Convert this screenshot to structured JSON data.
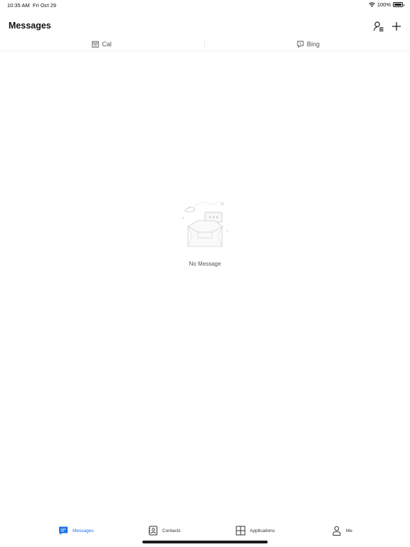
{
  "status_bar": {
    "time": "10:35 AM",
    "date": "Fri Oct 29",
    "battery": "100%",
    "wifi_icon": "wifi-icon",
    "battery_icon": "battery-icon"
  },
  "header": {
    "title": "Messages",
    "actions": [
      {
        "name": "contacts-list-icon"
      },
      {
        "name": "plus-icon"
      }
    ]
  },
  "sub_tabs": [
    {
      "label": "Cal",
      "icon": "calendar-icon"
    },
    {
      "label": "Bing",
      "icon": "bing-chat-icon"
    }
  ],
  "empty_state": {
    "message": "No Message",
    "illustration": "empty-inbox-illustration"
  },
  "bottom_nav": {
    "active_color": "#1a73e8",
    "items": [
      {
        "label": "Messages",
        "icon": "chat-bubble-icon",
        "active": true
      },
      {
        "label": "Contacts",
        "icon": "contacts-book-icon",
        "active": false
      },
      {
        "label": "Applications",
        "icon": "grid-icon",
        "active": false
      },
      {
        "label": "Me",
        "icon": "person-icon",
        "active": false
      }
    ]
  }
}
